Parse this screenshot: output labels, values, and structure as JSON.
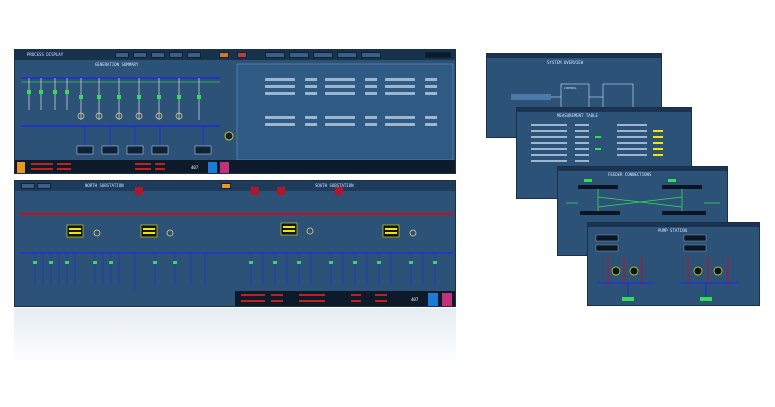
{
  "colors": {
    "panel": "#2c5278",
    "bus_red": "#b0182a",
    "bus_blue": "#2233cc",
    "green": "#33dd55",
    "yellow": "#f2e600",
    "orange": "#e8962a"
  },
  "panel_a": {
    "title": "PROCESS DISPLAY",
    "subtitle": "GENERATION SUMMARY",
    "counter": "407",
    "alarm_text": "ALARM"
  },
  "panel_b": {
    "left_title": "NORTH SUBSTATION",
    "right_title": "SOUTH SUBSTATION",
    "counter": "407"
  },
  "panel_c": {
    "title": "SYSTEM OVERVIEW",
    "box_label": "CONTROL"
  },
  "panel_d": {
    "title": "MEASUREMENT TABLE"
  },
  "panel_e": {
    "title": "FEEDER CONNECTIONS"
  },
  "panel_f": {
    "title": "PUMP STATION"
  }
}
